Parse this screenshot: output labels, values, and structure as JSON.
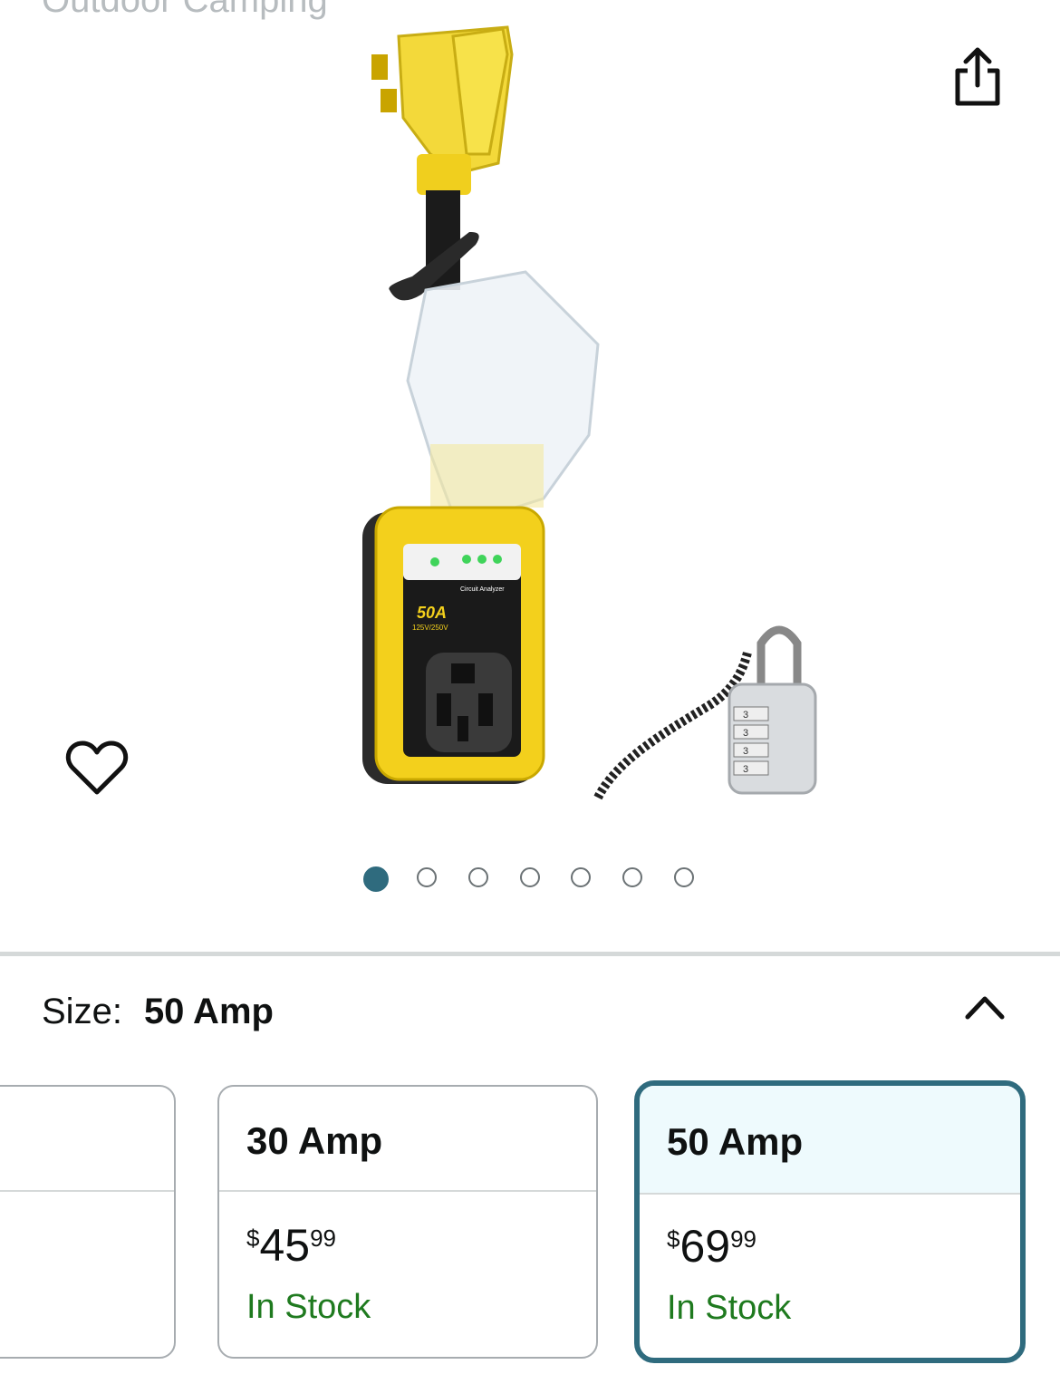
{
  "header": {
    "cut_text": "Outdoor Camping"
  },
  "gallery": {
    "share_icon": "share-icon",
    "favorite_icon": "heart-icon",
    "product_image": {
      "device_model": "50A",
      "device_rating": "125V/250V",
      "device_panel_title": "Circuit Analyzer",
      "lock_digits": [
        "3",
        "3",
        "3",
        "3"
      ]
    },
    "pagination": {
      "count": 7,
      "active_index": 0
    }
  },
  "size": {
    "label": "Size:",
    "selected": "50 Amp",
    "toggle_icon": "chevron-up-icon",
    "options": [
      {
        "title": "",
        "price_symbol": "",
        "price_whole": "",
        "price_fraction": "",
        "stock": ""
      },
      {
        "title": "30 Amp",
        "price_symbol": "$",
        "price_whole": "45",
        "price_fraction": "99",
        "stock": "In Stock"
      },
      {
        "title": "50 Amp",
        "price_symbol": "$",
        "price_whole": "69",
        "price_fraction": "99",
        "stock": "In Stock"
      }
    ]
  },
  "colors": {
    "accent": "#2f6b7e",
    "in_stock": "#1f7a1f",
    "selected_bg": "#eefafd",
    "divider": "#d5d9d9"
  }
}
